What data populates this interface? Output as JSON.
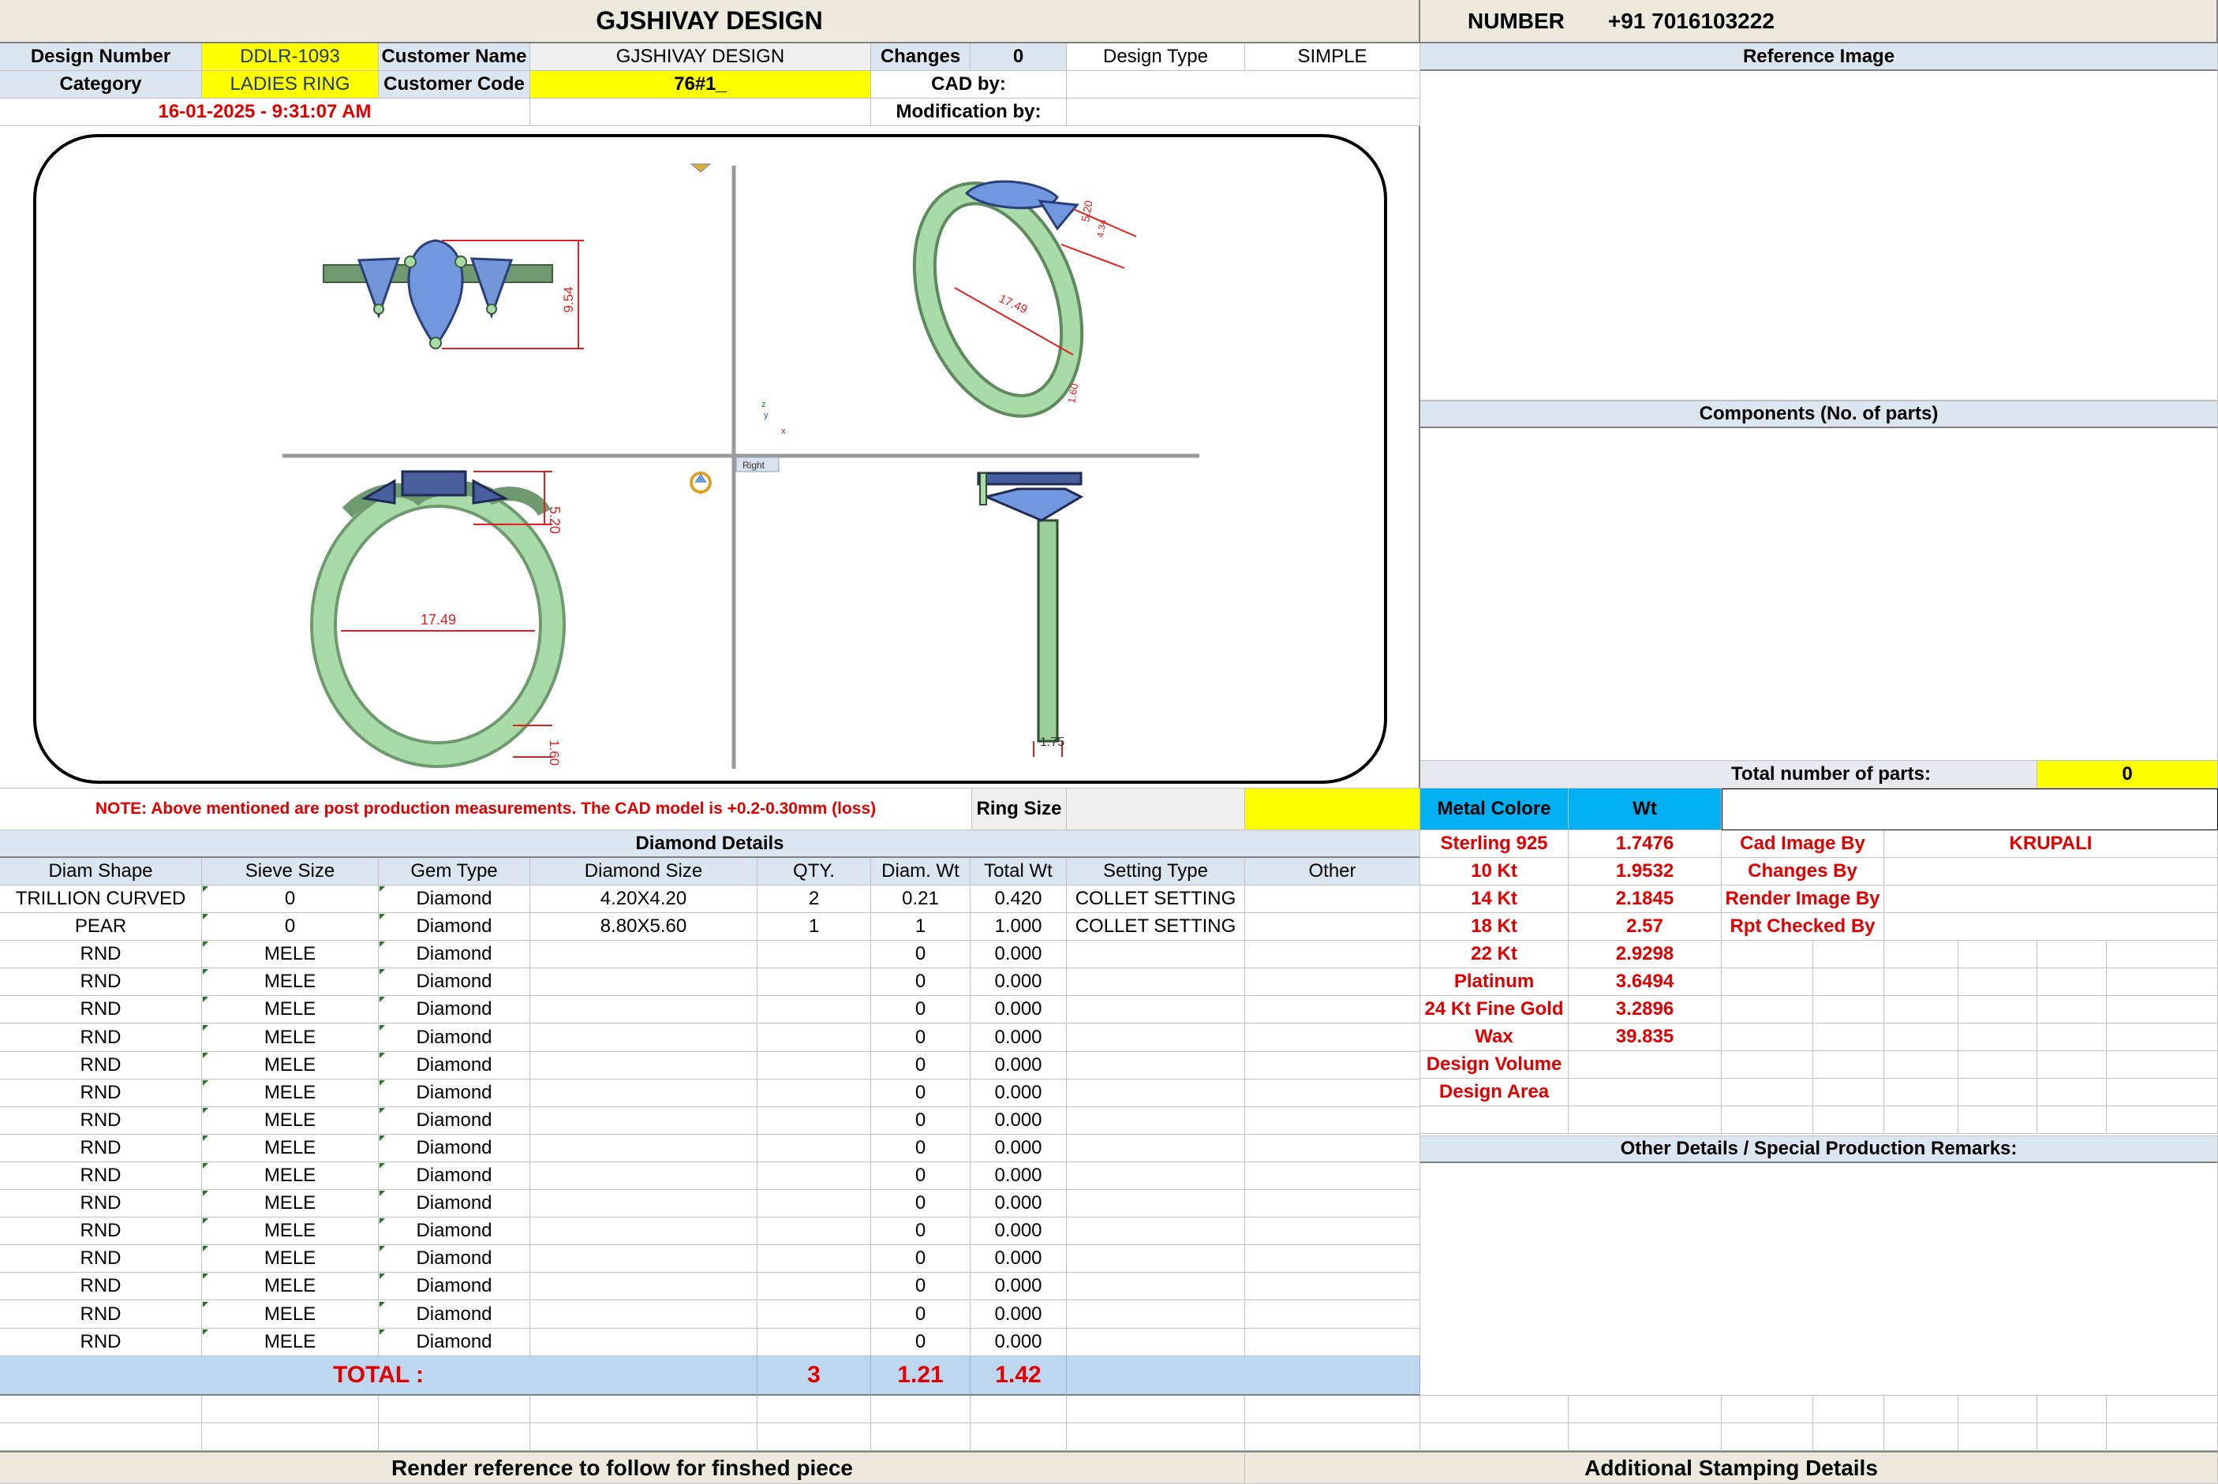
{
  "header": {
    "company": "GJSHIVAY DESIGN",
    "number_label": "NUMBER",
    "number_value": "+91 7016103222"
  },
  "info": {
    "design_number_label": "Design Number",
    "design_number": "DDLR-1093",
    "customer_name_label": "Customer Name",
    "customer_name": "GJSHIVAY DESIGN",
    "changes_label": "Changes",
    "changes": "0",
    "design_type_label": "Design Type",
    "design_type": "SIMPLE",
    "category_label": "Category",
    "category": "LADIES RING",
    "customer_code_label": "Customer Code",
    "customer_code": "76#1_",
    "cad_by_label": "CAD by:",
    "date": "16-01-2025 - 9:31:07 AM",
    "modification_label": "Modification by:"
  },
  "cad_image": {
    "dims": {
      "top_height": "9.54",
      "persp_width": "17.49",
      "persp_stone": "5.20",
      "persp_side": "4.34",
      "persp_bottom": "1.60",
      "front_stone": "5.20",
      "front_width": "17.49",
      "front_bottom": "1.60",
      "side_shank": "1.75"
    },
    "viewport_label": "Right",
    "axis_x": "x",
    "axis_y": "y",
    "axis_z": "z"
  },
  "right_panel": {
    "reference_image": "Reference Image",
    "components": "Components (No. of parts)",
    "total_parts_label": "Total number of parts:",
    "total_parts_value": "0",
    "other_details": "Other Details / Special Production Remarks:",
    "additional_stamping": "Additional Stamping Details"
  },
  "note": {
    "text": "NOTE: Above mentioned are post production measurements. The CAD model is +0.2-0.30mm (loss)",
    "ring_size_label": "Ring Size",
    "ring_size_value": ""
  },
  "metal": {
    "color_label": "Metal Colore",
    "wt_label": "Wt",
    "rows": [
      {
        "name": "Sterling 925",
        "wt": "1.7476"
      },
      {
        "name": "10 Kt",
        "wt": "1.9532"
      },
      {
        "name": "14 Kt",
        "wt": "2.1845"
      },
      {
        "name": "18 Kt",
        "wt": "2.57"
      },
      {
        "name": "22 Kt",
        "wt": "2.9298"
      },
      {
        "name": "Platinum",
        "wt": "3.6494"
      },
      {
        "name": "24 Kt Fine Gold",
        "wt": "3.2896"
      },
      {
        "name": "Wax",
        "wt": "39.835"
      },
      {
        "name": "Design Volume",
        "wt": ""
      },
      {
        "name": "Design Area",
        "wt": ""
      }
    ]
  },
  "credits": {
    "cad_image_by_label": "Cad Image By",
    "cad_image_by": "KRUPALI",
    "changes_by_label": "Changes By",
    "render_image_by_label": "Render Image By",
    "rpt_checked_by_label": "Rpt Checked By"
  },
  "diamond": {
    "title": "Diamond Details",
    "headers": [
      "Diam Shape",
      "Sieve Size",
      "Gem Type",
      "Diamond Size",
      "QTY.",
      "Diam. Wt",
      "Total Wt",
      "Setting Type",
      "Other"
    ],
    "rows": [
      [
        "TRILLION CURVED",
        "0",
        "Diamond",
        "4.20X4.20",
        "2",
        "0.21",
        "0.420",
        "COLLET SETTING",
        ""
      ],
      [
        "PEAR",
        "0",
        "Diamond",
        "8.80X5.60",
        "1",
        "1",
        "1.000",
        "COLLET SETTING",
        ""
      ],
      [
        "RND",
        "MELE",
        "Diamond",
        "",
        "",
        "0",
        "0.000",
        "",
        ""
      ],
      [
        "RND",
        "MELE",
        "Diamond",
        "",
        "",
        "0",
        "0.000",
        "",
        ""
      ],
      [
        "RND",
        "MELE",
        "Diamond",
        "",
        "",
        "0",
        "0.000",
        "",
        ""
      ],
      [
        "RND",
        "MELE",
        "Diamond",
        "",
        "",
        "0",
        "0.000",
        "",
        ""
      ],
      [
        "RND",
        "MELE",
        "Diamond",
        "",
        "",
        "0",
        "0.000",
        "",
        ""
      ],
      [
        "RND",
        "MELE",
        "Diamond",
        "",
        "",
        "0",
        "0.000",
        "",
        ""
      ],
      [
        "RND",
        "MELE",
        "Diamond",
        "",
        "",
        "0",
        "0.000",
        "",
        ""
      ],
      [
        "RND",
        "MELE",
        "Diamond",
        "",
        "",
        "0",
        "0.000",
        "",
        ""
      ],
      [
        "RND",
        "MELE",
        "Diamond",
        "",
        "",
        "0",
        "0.000",
        "",
        ""
      ],
      [
        "RND",
        "MELE",
        "Diamond",
        "",
        "",
        "0",
        "0.000",
        "",
        ""
      ],
      [
        "RND",
        "MELE",
        "Diamond",
        "",
        "",
        "0",
        "0.000",
        "",
        ""
      ],
      [
        "RND",
        "MELE",
        "Diamond",
        "",
        "",
        "0",
        "0.000",
        "",
        ""
      ],
      [
        "RND",
        "MELE",
        "Diamond",
        "",
        "",
        "0",
        "0.000",
        "",
        ""
      ],
      [
        "RND",
        "MELE",
        "Diamond",
        "",
        "",
        "0",
        "0.000",
        "",
        ""
      ],
      [
        "RND",
        "MELE",
        "Diamond",
        "",
        "",
        "0",
        "0.000",
        "",
        ""
      ]
    ],
    "total_label": "TOTAL :",
    "total_qty": "3",
    "total_diam_wt": "1.21",
    "total_wt": "1.42"
  },
  "footer": {
    "render_reference": "Render reference to follow for finshed piece"
  },
  "colors": {
    "highlight_yellow": "#ffff00",
    "header_blue": "#dce6f1",
    "metal_cyan": "#00b0f0",
    "warning_red": "#e00000",
    "ring_metal": "#a9dba8",
    "gem_blue": "#6f93d6"
  }
}
